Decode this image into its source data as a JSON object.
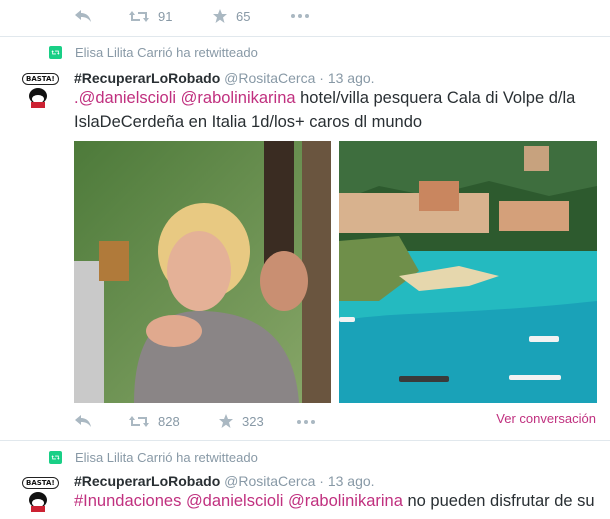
{
  "top_actions": {
    "retweets": "91",
    "favorites": "65"
  },
  "tweet1": {
    "retweeter": "Elisa Lilita Carrió ha retwitteado",
    "avatar_text": "BASTA!",
    "author_name": "#RecuperarLoRobado",
    "handle": "@RositaCerca",
    "dot": "·",
    "date": "13 ago.",
    "text_line1_prefix": ".",
    "mention1": "@danielscioli",
    "mention2": "@rabolinikarina",
    "text_line1_rest": " hotel/villa pesquera Cala di Volpe d/la",
    "text_line2": "IslaDeCerdeña en Italia 1d/los+ caros dl mundo",
    "retweets": "828",
    "favorites": "323",
    "view_conversation": "Ver conversación"
  },
  "tweet2": {
    "retweeter": "Elisa Lilita Carrió ha retwitteado",
    "avatar_text": "BASTA!",
    "author_name": "#RecuperarLoRobado",
    "handle": "@RositaCerca",
    "dot": "·",
    "date": "13 ago.",
    "hashtag": "#Inundaciones",
    "mention1": "@danielscioli",
    "mention2": "@rabolinikarina",
    "text_rest": " no pueden disfrutar de su"
  },
  "colors": {
    "accent": "#c0307f",
    "retweet_green": "#19cf86",
    "muted": "#8899a6"
  },
  "icons": [
    "reply-icon",
    "retweet-icon",
    "star-icon",
    "more-icon",
    "retweet-badge-icon"
  ]
}
